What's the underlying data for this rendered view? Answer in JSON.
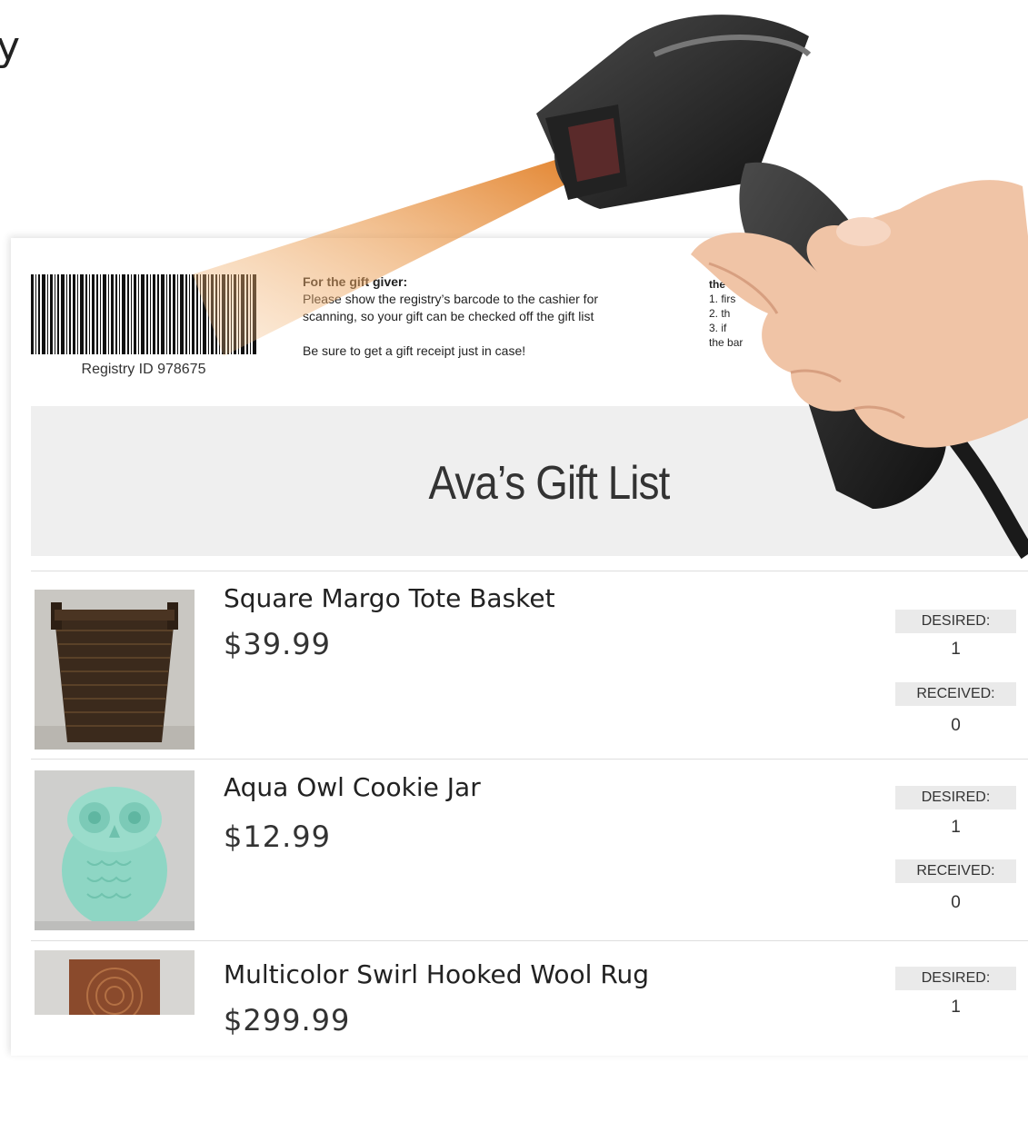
{
  "corner_glyph": "y",
  "registry": {
    "id_label": "Registry ID 978675"
  },
  "gift_giver": {
    "heading_prefix": "For the ",
    "heading_bold": "gift giver:",
    "line1": "Please show the registry’s barcode to the cashier for",
    "line2": "scanning, so your gift can be checked off the gift list",
    "receipt_note": "Be sure to get a gift receipt just in case!"
  },
  "cashier": {
    "heading": "the",
    "line1": "1. firs",
    "line2": "2. th",
    "line3": "3. if",
    "line4": "the bar"
  },
  "list_title": "Ava’s Gift List",
  "items": [
    {
      "name": "Square Margo Tote Basket",
      "price": "$39.99",
      "desired_label": "DESIRED:",
      "desired": "1",
      "received_label": "RECEIVED:",
      "received": "0"
    },
    {
      "name": "Aqua Owl Cookie Jar",
      "price": "$12.99",
      "desired_label": "DESIRED:",
      "desired": "1",
      "received_label": "RECEIVED:",
      "received": "0"
    },
    {
      "name": "Multicolor Swirl Hooked Wool Rug",
      "price": "$299.99",
      "desired_label": "DESIRED:",
      "desired": "1"
    }
  ]
}
